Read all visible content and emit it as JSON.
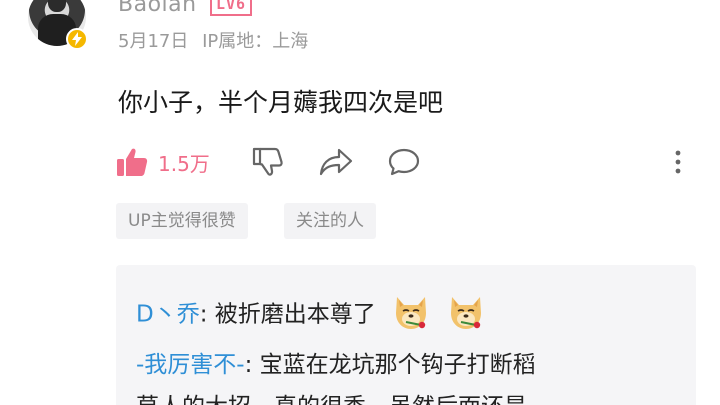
{
  "comment": {
    "username": "Baolan",
    "level": "LV6",
    "date": "5月17日",
    "ip_location": "IP属地：上海",
    "text": "你小子，半个月薅我四次是吧"
  },
  "actions": {
    "like_count": "1.5万"
  },
  "tags": [
    "UP主觉得很赞",
    "关注的人"
  ],
  "replies": [
    {
      "author": "D丶乔",
      "text": "被折磨出本尊了"
    },
    {
      "author": "-我厉害不-",
      "text": "宝蓝在龙坑那个钩子打断稻"
    },
    {
      "author": "",
      "text": "草人的大招，真的很秀，虽然后面还是"
    }
  ],
  "colors": {
    "accent_pink": "#f06e8a",
    "reply_author_blue": "#2f8fd6",
    "vip_badge": "#f5b800"
  }
}
